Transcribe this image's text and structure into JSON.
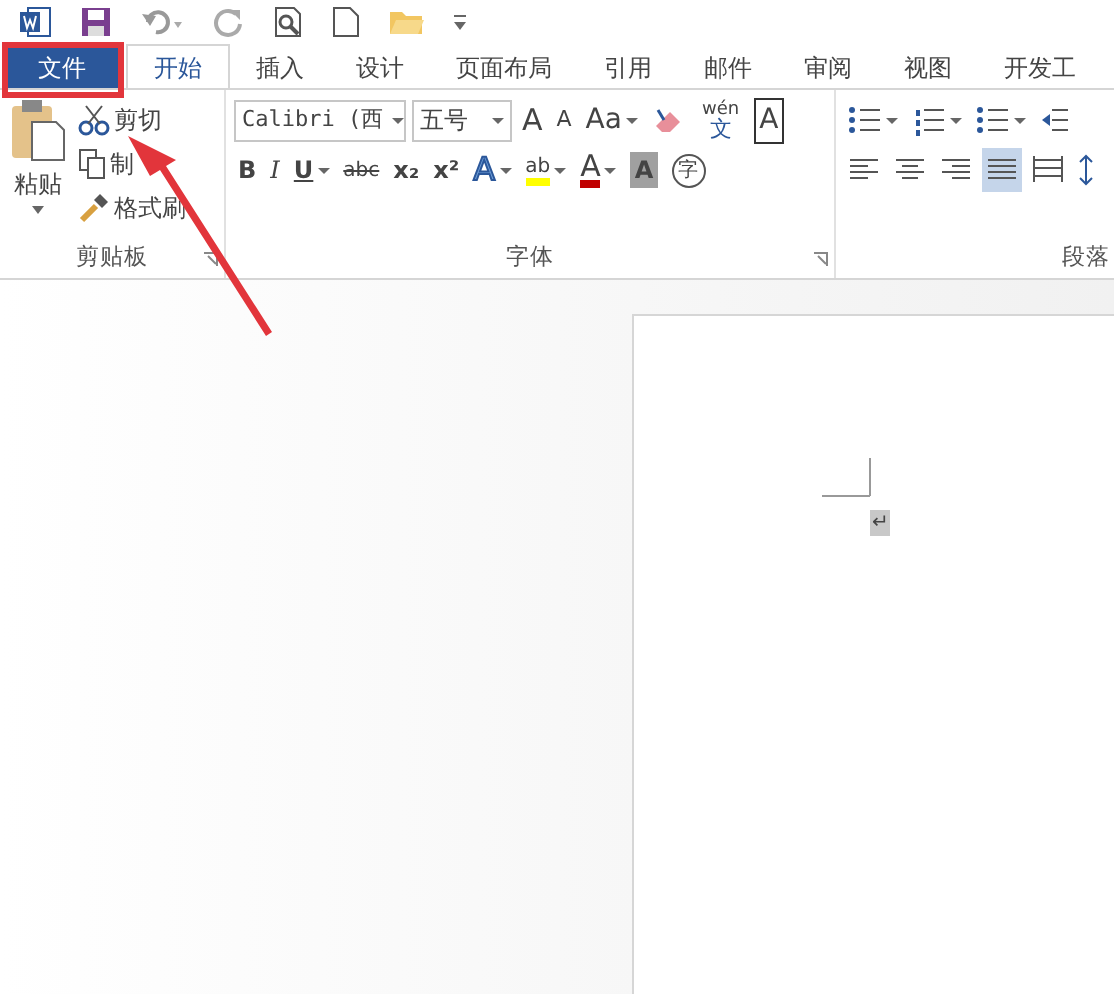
{
  "tabs": [
    {
      "label": "文件",
      "kind": "file",
      "selected": false
    },
    {
      "label": "开始",
      "kind": "tab",
      "selected": true
    },
    {
      "label": "插入",
      "kind": "tab",
      "selected": false
    },
    {
      "label": "设计",
      "kind": "tab",
      "selected": false
    },
    {
      "label": "页面布局",
      "kind": "tab",
      "selected": false
    },
    {
      "label": "引用",
      "kind": "tab",
      "selected": false
    },
    {
      "label": "邮件",
      "kind": "tab",
      "selected": false
    },
    {
      "label": "审阅",
      "kind": "tab",
      "selected": false
    },
    {
      "label": "视图",
      "kind": "tab",
      "selected": false
    },
    {
      "label": "开发工",
      "kind": "tab",
      "selected": false
    }
  ],
  "clipboard": {
    "paste": "粘贴",
    "cut": "剪切",
    "copy": "制",
    "format_painter": "格式刷",
    "group_label": "剪贴板"
  },
  "font": {
    "font_name": "Calibri (西",
    "font_size": "五号",
    "group_label": "字体",
    "row_1": [
      {
        "kind": "grow",
        "label": "A",
        "dropdown": false
      },
      {
        "kind": "shrink",
        "label": "A",
        "dropdown": false
      },
      {
        "kind": "case",
        "label": "Aa",
        "dropdown": true
      },
      {
        "kind": "eraser"
      },
      {
        "kind": "phonetic",
        "label": "wén",
        "sub_label": "文",
        "dropdown": false
      },
      {
        "kind": "border",
        "label": "A",
        "dropdown": false
      }
    ],
    "row_2": [
      {
        "kind": "bold",
        "label": "B",
        "dropdown": false
      },
      {
        "kind": "italic",
        "label": "I",
        "dropdown": false
      },
      {
        "kind": "underline",
        "label": "U",
        "dropdown": true
      },
      {
        "kind": "strike",
        "label": "abc",
        "dropdown": false
      },
      {
        "kind": "sub",
        "label": "x₂",
        "dropdown": false
      },
      {
        "kind": "sup",
        "label": "x²",
        "dropdown": false
      },
      {
        "kind": "effects",
        "label": "A",
        "dropdown": true
      },
      {
        "kind": "highlight",
        "label": "ab",
        "dropdown": true
      },
      {
        "kind": "color",
        "label": "A",
        "dropdown": true
      },
      {
        "kind": "shading",
        "label": "A",
        "dropdown": false
      },
      {
        "kind": "circle",
        "label": "字",
        "dropdown": false
      }
    ]
  },
  "paragraph": {
    "group_label": "段落",
    "alignments": [
      {
        "selected": false
      },
      {
        "selected": false
      },
      {
        "selected": false
      },
      {
        "selected": true
      },
      {
        "selected": false
      }
    ]
  },
  "document": {
    "paragraph_mark": "↵"
  }
}
